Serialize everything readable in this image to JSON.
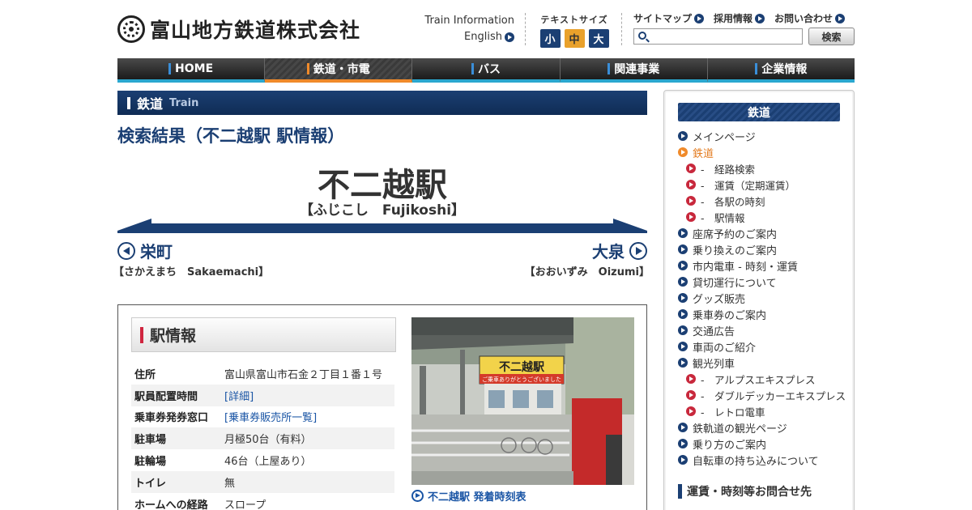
{
  "header": {
    "company_name": "富山地方鉄道株式会社",
    "train_info": "Train Information",
    "english": "English",
    "text_size_label": "テキストサイズ",
    "text_size_small": "小",
    "text_size_medium": "中",
    "text_size_large": "大",
    "sitemap": "サイトマップ",
    "recruit": "採用情報",
    "contact": "お問い合わせ",
    "search_placeholder": "",
    "search_button": "検索"
  },
  "nav": {
    "items": [
      {
        "label": "HOME"
      },
      {
        "label": "鉄道・市電"
      },
      {
        "label": "バス"
      },
      {
        "label": "関連事業"
      },
      {
        "label": "企業情報"
      }
    ],
    "active_index": 1
  },
  "main": {
    "section_title": "鉄道",
    "section_subtitle": "Train",
    "page_title": "検索結果（不二越駅 駅情報）",
    "station_name": "不二越駅",
    "station_reading": "【ふじこし　Fujikoshi】",
    "prev_station": "栄町",
    "prev_reading": "【さかえまち　Sakaemachi】",
    "next_station": "大泉",
    "next_reading": "【おおいずみ　Oizumi】",
    "info_title": "駅情報",
    "info_rows": [
      {
        "key": "住所",
        "value": "富山県富山市石金２丁目１番１号",
        "link": false
      },
      {
        "key": "駅員配置時間",
        "value": "[詳細]",
        "link": true
      },
      {
        "key": "乗車券発券窓口",
        "value": "[乗車券販売所一覧]",
        "link": true
      },
      {
        "key": "駐車場",
        "value": "月極50台（有料）",
        "link": false
      },
      {
        "key": "駐輪場",
        "value": "46台（上屋あり）",
        "link": false
      },
      {
        "key": "トイレ",
        "value": "無",
        "link": false
      },
      {
        "key": "ホームへの経路",
        "value": "スロープ",
        "link": false
      }
    ],
    "photo_sign": "不二越駅",
    "photo_sign_sub": "ご乗車ありがとうございました",
    "timetable_link": "不二越駅 発着時刻表"
  },
  "sidebar": {
    "title": "鉄道",
    "items": [
      {
        "label": "メインページ",
        "type": "main"
      },
      {
        "label": "鉄道",
        "type": "active"
      },
      {
        "label": "-　経路検索",
        "type": "sub"
      },
      {
        "label": "-　運賃（定期運賃）",
        "type": "sub"
      },
      {
        "label": "-　各駅の時刻",
        "type": "sub"
      },
      {
        "label": "-　駅情報",
        "type": "sub"
      },
      {
        "label": "座席予約のご案内",
        "type": "main"
      },
      {
        "label": "乗り換えのご案内",
        "type": "main"
      },
      {
        "label": "市内電車 - 時刻・運賃",
        "type": "main"
      },
      {
        "label": "貸切運行について",
        "type": "main"
      },
      {
        "label": "グッズ販売",
        "type": "main"
      },
      {
        "label": "乗車券のご案内",
        "type": "main"
      },
      {
        "label": "交通広告",
        "type": "main"
      },
      {
        "label": "車両のご紹介",
        "type": "main"
      },
      {
        "label": "観光列車",
        "type": "main"
      },
      {
        "label": "-　アルプスエキスプレス",
        "type": "sub"
      },
      {
        "label": "-　ダブルデッカーエキスプレス",
        "type": "sub"
      },
      {
        "label": "-　レトロ電車",
        "type": "sub"
      },
      {
        "label": "鉄軌道の観光ページ",
        "type": "main"
      },
      {
        "label": "乗り方のご案内",
        "type": "main"
      },
      {
        "label": "自転車の持ち込みについて",
        "type": "main"
      }
    ],
    "contact_heading": "運賃・時刻等お問合せ先"
  },
  "colors": {
    "navy": "#1b3f73",
    "orange": "#f08a2a",
    "red": "#c8283c",
    "nav_underline": "#2aa7cf",
    "link": "#1a55a5"
  }
}
